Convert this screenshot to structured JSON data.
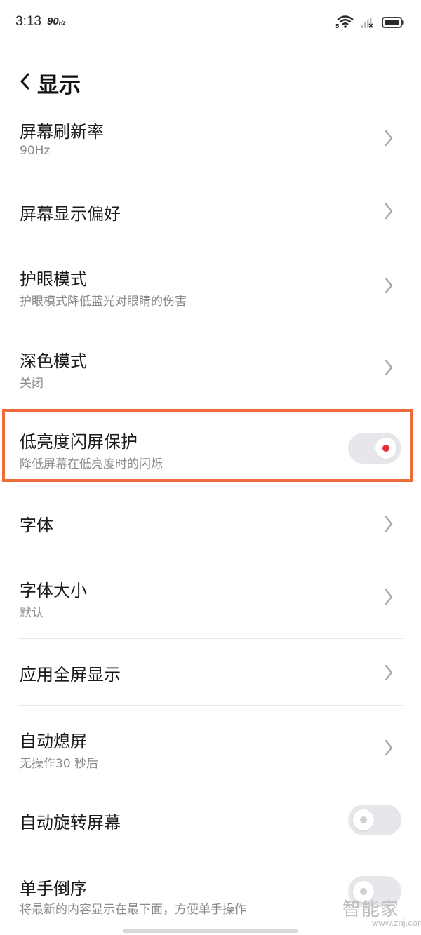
{
  "status_bar": {
    "time": "3:13",
    "refresh_badge": "90",
    "refresh_badge_unit": "Hz",
    "wifi_badge": "5"
  },
  "header": {
    "title": "显示"
  },
  "settings": [
    {
      "title": "屏幕刷新率",
      "subtitle": "90Hz",
      "control": "chevron"
    },
    {
      "title": "屏幕显示偏好",
      "control": "chevron"
    },
    {
      "title": "护眼模式",
      "subtitle": "护眼模式降低蓝光对眼睛的伤害",
      "control": "chevron"
    },
    {
      "title": "深色模式",
      "subtitle": "关闭",
      "control": "chevron"
    },
    {
      "title": "低亮度闪屏保护",
      "subtitle": "降低屏幕在低亮度时的闪烁",
      "control": "toggle",
      "toggle_on": true,
      "highlighted": true
    },
    {
      "title": "字体",
      "control": "chevron"
    },
    {
      "title": "字体大小",
      "subtitle": "默认",
      "control": "chevron"
    },
    {
      "title": "应用全屏显示",
      "control": "chevron"
    },
    {
      "title": "自动熄屏",
      "subtitle": "无操作30 秒后",
      "control": "chevron"
    },
    {
      "title": "自动旋转屏幕",
      "control": "toggle",
      "toggle_on": false
    },
    {
      "title": "单手倒序",
      "subtitle": "将最新的内容显示在最下面，方便单手操作",
      "control": "toggle",
      "toggle_on": false
    }
  ],
  "watermark": {
    "logo": "智能家",
    "url": "www.znj.com"
  },
  "colors": {
    "highlight": "#ef6b3a",
    "toggle_on_dot": "#e8303a",
    "toggle_off_dot": "#cfcfd4",
    "toggle_track": "#e6e6eb"
  }
}
